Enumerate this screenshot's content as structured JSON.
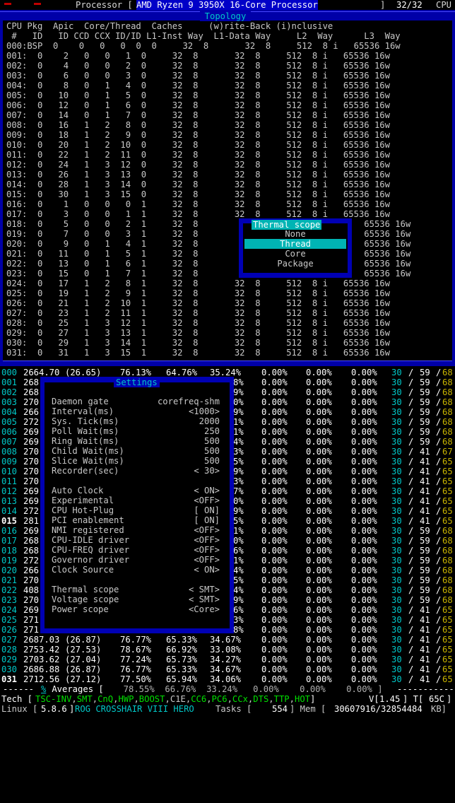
{
  "header": {
    "processor_label": "Processor [",
    "processor_name": "AMD Ryzen 9 3950X 16-Core Processor",
    "bracket_close": "]",
    "cpu_count": "32/32",
    "cpu_suffix": "CPU"
  },
  "topology": {
    "title": "Topology",
    "header_line1": "CPU Pkg  Apic  Core/Thread  Caches     (w)rite-Back (i)nclusive",
    "header_line2": " #   ID   ID CCD CCX ID/ID L1-Inst Way  L1-Data Way     L2  Way      L3  Way",
    "rows": [
      "000:BSP  0    0   0   0  0  0     32  8       32  8     512  8 i   65536 16w",
      "001:  0    2   0   0   1  0     32  8       32  8     512  8 i   65536 16w",
      "002:  0    4   0   0   2  0     32  8       32  8     512  8 i   65536 16w",
      "003:  0    6   0   0   3  0     32  8       32  8     512  8 i   65536 16w",
      "004:  0    8   0   1   4  0     32  8       32  8     512  8 i   65536 16w",
      "005:  0   10   0   1   5  0     32  8       32  8     512  8 i   65536 16w",
      "006:  0   12   0   1   6  0     32  8       32  8     512  8 i   65536 16w",
      "007:  0   14   0   1   7  0     32  8       32  8     512  8 i   65536 16w",
      "008:  0   16   1   2   8  0     32  8       32  8     512  8 i   65536 16w",
      "009:  0   18   1   2   9  0     32  8       32  8     512  8 i   65536 16w",
      "010:  0   20   1   2  10  0     32  8       32  8     512  8 i   65536 16w",
      "011:  0   22   1   2  11  0     32  8       32  8     512  8 i   65536 16w",
      "012:  0   24   1   3  12  0     32  8       32  8     512  8 i   65536 16w",
      "013:  0   26   1   3  13  0     32  8       32  8     512  8 i   65536 16w",
      "014:  0   28   1   3  14  0     32  8       32  8     512  8 i   65536 16w",
      "015:  0   30   1   3  15  0     32  8       32  8     512  8 i   65536 16w",
      "016:  0    1   0   0   0  1     32  8       32  8     512  8 i   65536 16w",
      "017:  0    3   0   0   1  1     32  8       32  8     512  8 i   65536 16w",
      "018:  0    5   0   0   2  1     32  8                          8 i   65536 16w",
      "019:  0    7   0   0   3  1     32  8                          8 i   65536 16w",
      "020:  0    9   0   1   4  1     32  8                          8 i   65536 16w",
      "021:  0   11   0   1   5  1     32  8                          8 i   65536 16w",
      "022:  0   13   0   1   6  1     32  8                          8 i   65536 16w",
      "023:  0   15   0   1   7  1     32  8                          8 i   65536 16w",
      "024:  0   17   1   2   8  1     32  8       32  8     512  8 i   65536 16w",
      "025:  0   19   1   2   9  1     32  8       32  8     512  8 i   65536 16w",
      "026:  0   21   1   2  10  1     32  8       32  8     512  8 i   65536 16w",
      "027:  0   23   1   2  11  1     32  8       32  8     512  8 i   65536 16w",
      "028:  0   25   1   3  12  1     32  8       32  8     512  8 i   65536 16w",
      "029:  0   27   1   3  13  1     32  8       32  8     512  8 i   65536 16w",
      "030:  0   29   1   3  14  1     32  8       32  8     512  8 i   65536 16w",
      "031:  0   31   1   3  15  1     32  8       32  8     512  8 i   65536 16w"
    ]
  },
  "thermal_menu": {
    "title": "Thermal scope",
    "options": [
      "None",
      "Thread",
      "Core",
      "Package"
    ],
    "selected": "Thread"
  },
  "settings": {
    "title": "Settings",
    "rows": [
      {
        "k": "Daemon gate",
        "v": "corefreq-shm"
      },
      {
        "k": "Interval(ms)",
        "v": "<1000>"
      },
      {
        "k": "Sys. Tick(ms)",
        "v": "2000"
      },
      {
        "k": "Poll Wait(ms)",
        "v": "250"
      },
      {
        "k": "Ring Wait(ms)",
        "v": "500"
      },
      {
        "k": "Child Wait(ms)",
        "v": "500"
      },
      {
        "k": "Slice Wait(ms)",
        "v": "500"
      },
      {
        "k": "Recorder(sec)",
        "v": "<  30>"
      },
      {
        "k": "",
        "v": ""
      },
      {
        "k": "Auto Clock",
        "v": "< ON>"
      },
      {
        "k": "Experimental",
        "v": "<OFF>"
      },
      {
        "k": "CPU Hot-Plug",
        "v": "[ ON]"
      },
      {
        "k": "PCI enablement",
        "v": "[ ON]"
      },
      {
        "k": "NMI registered",
        "v": "<OFF>"
      },
      {
        "k": "CPU-IDLE driver",
        "v": "<OFF>"
      },
      {
        "k": "CPU-FREQ driver",
        "v": "<OFF>"
      },
      {
        "k": "Governor driver",
        "v": "<OFF>"
      },
      {
        "k": "Clock Source",
        "v": "< ON>"
      },
      {
        "k": "",
        "v": ""
      },
      {
        "k": "Thermal scope",
        "v": "< SMT>"
      },
      {
        "k": "Voltage scope",
        "v": "< SMT>"
      },
      {
        "k": "Power scope",
        "v": "<Core>"
      }
    ]
  },
  "cores": [
    {
      "id": "000",
      "freq": "2664.70",
      "ratio": "(26.65)",
      "c0": "76.13%",
      "c1": "64.76%",
      "c3": "35.24%",
      "tail": "9%"
    },
    {
      "id": "001",
      "freq": "268",
      "tail": "8%"
    },
    {
      "id": "002",
      "freq": "268",
      "tail": "9%"
    },
    {
      "id": "003",
      "freq": "270",
      "tail": "0%"
    },
    {
      "id": "004",
      "freq": "266",
      "tail": "9%"
    },
    {
      "id": "005",
      "freq": "272",
      "tail": "1%"
    },
    {
      "id": "006",
      "freq": "269",
      "tail": "1%"
    },
    {
      "id": "007",
      "freq": "269",
      "tail": "4%"
    },
    {
      "id": "008",
      "freq": "270",
      "tail": "3%"
    },
    {
      "id": "009",
      "freq": "270",
      "tail": "5%"
    },
    {
      "id": "010",
      "freq": "270",
      "tail": "9%"
    },
    {
      "id": "011",
      "freq": "270",
      "tail": "3%"
    },
    {
      "id": "012",
      "freq": "269",
      "tail": "7%"
    },
    {
      "id": "013",
      "freq": "269",
      "tail": "0%"
    },
    {
      "id": "014",
      "freq": "272",
      "tail": "9%"
    },
    {
      "id": "015",
      "freq": "281",
      "tail": "5%"
    },
    {
      "id": "016",
      "freq": "269",
      "tail": "1%"
    },
    {
      "id": "017",
      "freq": "268",
      "tail": "0%"
    },
    {
      "id": "018",
      "freq": "268",
      "tail": "6%"
    },
    {
      "id": "019",
      "freq": "272",
      "tail": "1%"
    },
    {
      "id": "020",
      "freq": "266",
      "tail": "4%"
    },
    {
      "id": "021",
      "freq": "270",
      "tail": "5%"
    },
    {
      "id": "022",
      "freq": "408",
      "tail": "4%"
    },
    {
      "id": "023",
      "freq": "270",
      "tail": "9%"
    },
    {
      "id": "024",
      "freq": "269",
      "tail": "6%"
    },
    {
      "id": "025",
      "freq": "271",
      "tail": "3%"
    },
    {
      "id": "026",
      "freq": "271",
      "tail": "8%"
    },
    {
      "id": "027",
      "freq": "2687.03",
      "ratio": "(26.87)",
      "c0": "76.77%",
      "c1": "65.33%",
      "c3": "34.67%",
      "tail": ""
    },
    {
      "id": "028",
      "freq": "2753.42",
      "ratio": "(27.53)",
      "c0": "78.67%",
      "c1": "66.92%",
      "c3": "33.08%",
      "tail": ""
    },
    {
      "id": "029",
      "freq": "2703.62",
      "ratio": "(27.04)",
      "c0": "77.24%",
      "c1": "65.73%",
      "c3": "34.27%",
      "tail": ""
    },
    {
      "id": "030",
      "freq": "2686.88",
      "ratio": "(26.87)",
      "c0": "76.77%",
      "c1": "65.33%",
      "c3": "34.67%",
      "tail": ""
    },
    {
      "id": "031",
      "freq": "2712.56",
      "ratio": "(27.12)",
      "c0": "77.50%",
      "c1": "65.94%",
      "c3": "34.06%",
      "tail": ""
    }
  ],
  "core_right": [
    {
      "a": "30",
      "b": "59",
      "c": "68"
    },
    {
      "a": "30",
      "b": "59",
      "c": "68"
    },
    {
      "a": "30",
      "b": "59",
      "c": "68"
    },
    {
      "a": "30",
      "b": "59",
      "c": "68"
    },
    {
      "a": "30",
      "b": "59",
      "c": "68"
    },
    {
      "a": "30",
      "b": "59",
      "c": "68"
    },
    {
      "a": "30",
      "b": "59",
      "c": "68"
    },
    {
      "a": "30",
      "b": "59",
      "c": "68"
    },
    {
      "a": "30",
      "b": "41",
      "c": "67"
    },
    {
      "a": "30",
      "b": "41",
      "c": "65"
    },
    {
      "a": "30",
      "b": "41",
      "c": "65"
    },
    {
      "a": "30",
      "b": "41",
      "c": "65"
    },
    {
      "a": "30",
      "b": "41",
      "c": "65"
    },
    {
      "a": "30",
      "b": "41",
      "c": "65"
    },
    {
      "a": "30",
      "b": "41",
      "c": "65"
    },
    {
      "a": "30",
      "b": "41",
      "c": "65"
    },
    {
      "a": "30",
      "b": "59",
      "c": "68"
    },
    {
      "a": "30",
      "b": "59",
      "c": "68"
    },
    {
      "a": "30",
      "b": "59",
      "c": "68"
    },
    {
      "a": "30",
      "b": "59",
      "c": "68"
    },
    {
      "a": "30",
      "b": "59",
      "c": "68"
    },
    {
      "a": "30",
      "b": "59",
      "c": "68"
    },
    {
      "a": "30",
      "b": "59",
      "c": "68"
    },
    {
      "a": "30",
      "b": "59",
      "c": "68"
    },
    {
      "a": "30",
      "b": "41",
      "c": "65"
    },
    {
      "a": "30",
      "b": "41",
      "c": "65"
    },
    {
      "a": "30",
      "b": "41",
      "c": "65"
    },
    {
      "a": "30",
      "b": "41",
      "c": "65"
    },
    {
      "a": "30",
      "b": "41",
      "c": "65"
    },
    {
      "a": "30",
      "b": "41",
      "c": "65"
    },
    {
      "a": "30",
      "b": "41",
      "c": "65"
    },
    {
      "a": "30",
      "b": "41",
      "c": "65"
    }
  ],
  "zero_pct": "0.00%",
  "averages": {
    "prefix": "------ ",
    "pct": "%",
    "label": " Averages [",
    "values": "  78.55%  66.76%  33.24%   0.00%    0.00%    0.00% ]",
    "suffix": "-----------"
  },
  "tech": {
    "label": "Tech [",
    "items": [
      "TSC-INV",
      "SMT",
      "CnQ",
      "HWP",
      "BOOST",
      "C1E",
      "CC6",
      "PC6",
      "CCx",
      "DTS",
      "TTP",
      "HOT"
    ],
    "close": "]",
    "v_label": "V[",
    "voltage": "1.45",
    "t_label": "] T[",
    "temp": "65C",
    "t_close": "]"
  },
  "status": {
    "os": "Linux [",
    "kernel": "5.8.6",
    "board": "ROG CROSSHAIR VIII HERO",
    "tasks_label": "Tasks [",
    "tasks": "554",
    "mem_label": "] Mem [",
    "mem": "30607916/32854484",
    "mem_unit": "KB]"
  }
}
